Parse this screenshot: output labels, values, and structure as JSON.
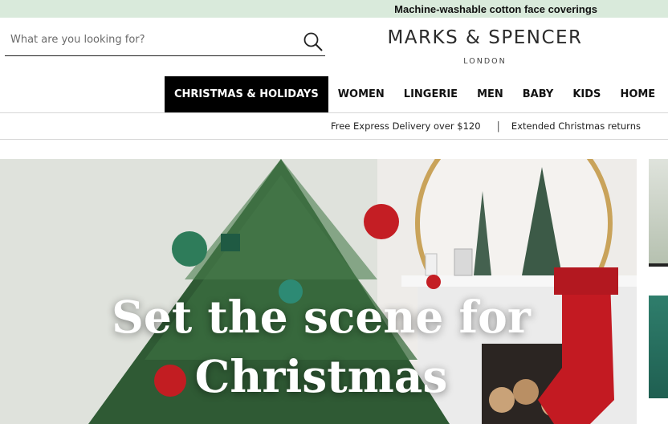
{
  "promo": {
    "text": "Machine-washable cotton face coverings"
  },
  "search": {
    "placeholder": "What are you looking for?"
  },
  "logo": {
    "main": "MARKS & SPENCER",
    "sub": "LONDON"
  },
  "nav": {
    "items": [
      {
        "label": "CHRISTMAS & HOLIDAYS",
        "active": true
      },
      {
        "label": "WOMEN"
      },
      {
        "label": "LINGERIE"
      },
      {
        "label": "MEN"
      },
      {
        "label": "BABY"
      },
      {
        "label": "KIDS"
      },
      {
        "label": "HOME"
      }
    ]
  },
  "info_bar": {
    "delivery": "Free Express Delivery over $120",
    "separator": "|",
    "returns": "Extended Christmas returns"
  },
  "hero": {
    "headline_line1": "Set the scene for",
    "headline_line2": "Christmas"
  },
  "colors": {
    "promo_bg": "#d9eadb",
    "active_nav_bg": "#000000",
    "tree_green": "#2f5a34",
    "ornament_red": "#c41e24"
  },
  "icons": {
    "search": "search-icon"
  }
}
